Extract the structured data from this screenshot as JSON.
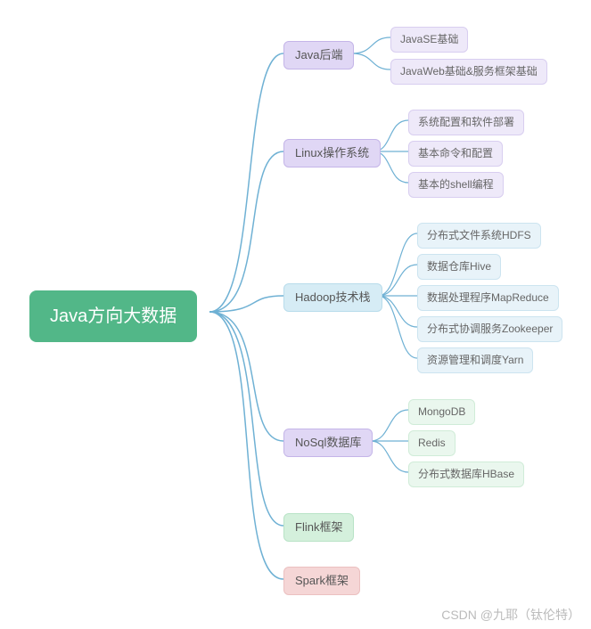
{
  "root": "Java方向大数据",
  "branches": [
    {
      "label": "Java后端",
      "children": [
        "JavaSE基础",
        "JavaWeb基础&服务框架基础"
      ]
    },
    {
      "label": "Linux操作系统",
      "children": [
        "系统配置和软件部署",
        "基本命令和配置",
        "基本的shell编程"
      ]
    },
    {
      "label": "Hadoop技术栈",
      "children": [
        "分布式文件系统HDFS",
        "数据仓库Hive",
        "数据处理程序MapReduce",
        "分布式协调服务Zookeeper",
        "资源管理和调度Yarn"
      ]
    },
    {
      "label": "NoSql数据库",
      "children": [
        "MongoDB",
        "Redis",
        "分布式数据库HBase"
      ]
    },
    {
      "label": "Flink框架",
      "children": []
    },
    {
      "label": "Spark框架",
      "children": []
    }
  ],
  "watermark": "CSDN @九耶（钛伦特）"
}
